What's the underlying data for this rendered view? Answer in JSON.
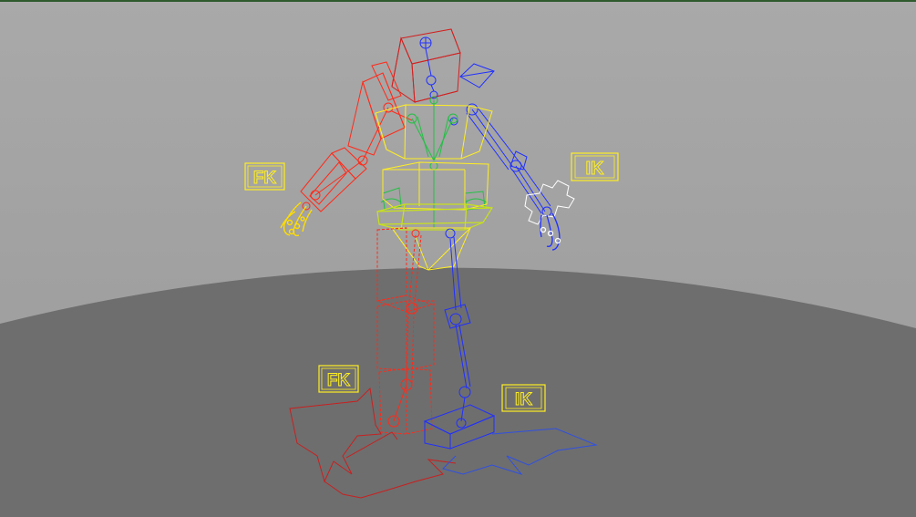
{
  "viewport": {
    "label": "perspective-viewport",
    "background": "#a6a6a6",
    "ground_color": "#6e6e6e"
  },
  "rig": {
    "colors": {
      "left_side": "#ff2a1a",
      "right_side": "#2030ff",
      "center": "#ffee22",
      "spine": "#22c044"
    },
    "switch_labels": {
      "arm_left": "FK",
      "arm_right": "IK",
      "leg_left": "FK",
      "leg_right": "IK"
    }
  }
}
